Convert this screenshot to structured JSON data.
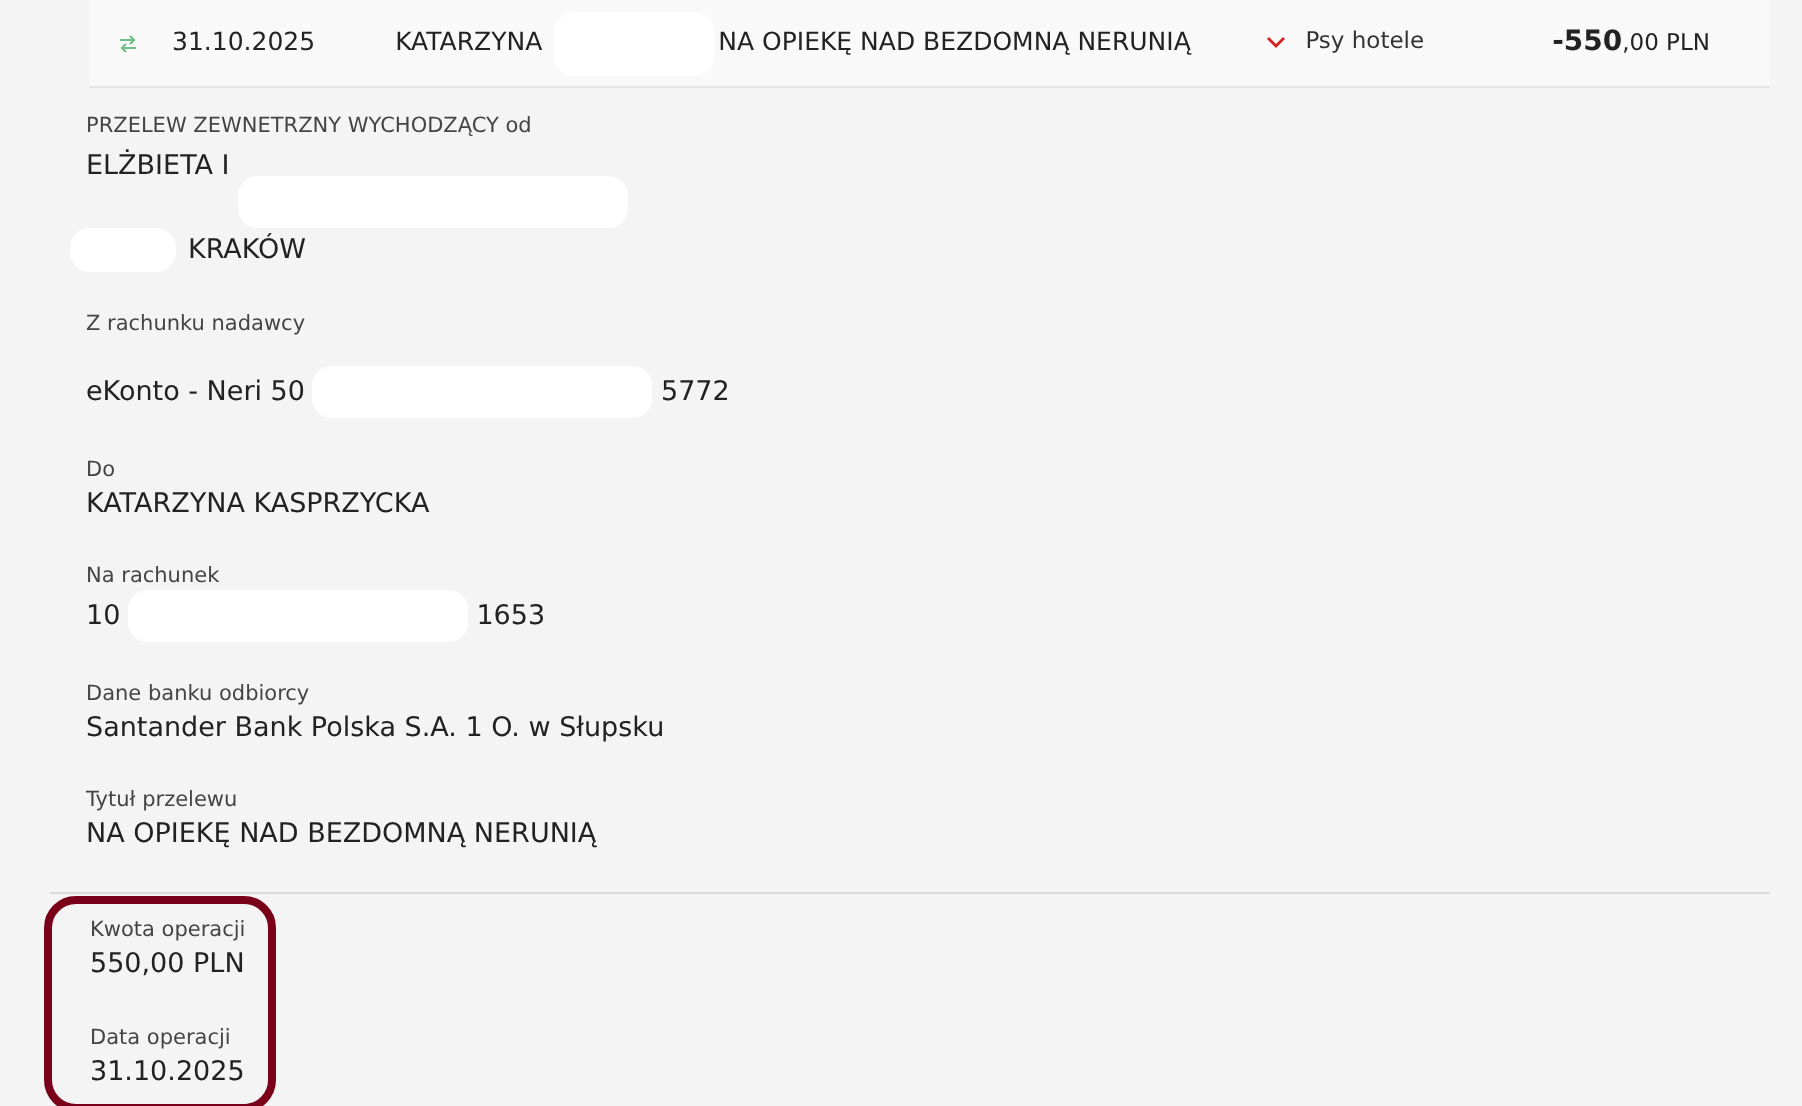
{
  "transaction": {
    "date": "31.10.2025",
    "counterparty": "KATARZYNA",
    "counterparty_redacted": true,
    "title": "NA OPIEKĘ NAD BEZDOMNĄ NERUNIĄ",
    "category": "Psy hotele",
    "expanded": true,
    "amount_main": "-550",
    "amount_rest": ",00 PLN"
  },
  "details": [
    {
      "label": "PRZELEW ZEWNETRZNY WYCHODZĄCY od",
      "lines": [
        [
          {
            "kind": "text",
            "text": "ELŻBIETA I"
          },
          {
            "kind": "redaction"
          }
        ],
        [
          {
            "kind": "redaction"
          },
          {
            "kind": "text",
            "text": "KRAKÓW"
          }
        ]
      ]
    },
    {
      "label": "Z rachunku nadawcy",
      "lines": [
        [
          {
            "kind": "text",
            "text": "eKonto - Neri 50"
          },
          {
            "kind": "redaction"
          },
          {
            "kind": "text",
            "text": "5772"
          }
        ]
      ]
    },
    {
      "label": "Do",
      "lines": [
        [
          {
            "kind": "text",
            "text": "KATARZYNA KASPRZYCKA"
          }
        ]
      ]
    },
    {
      "label": "Na rachunek",
      "lines": [
        [
          {
            "kind": "text",
            "text": "10"
          },
          {
            "kind": "redaction"
          },
          {
            "kind": "text",
            "text": "1653"
          }
        ]
      ]
    },
    {
      "label": "Dane banku odbiorcy",
      "lines": [
        [
          {
            "kind": "text",
            "text": "Santander Bank Polska S.A. 1 O. w Słupsku"
          }
        ]
      ]
    },
    {
      "label": "Tytuł przelewu",
      "lines": [
        [
          {
            "kind": "text",
            "text": "NA OPIEKĘ NAD BEZDOMNĄ NERUNIĄ"
          }
        ]
      ]
    }
  ],
  "summary": {
    "highlighted": true,
    "fields": [
      {
        "label": "Kwota operacji",
        "value": "550,00 PLN"
      },
      {
        "label": "Data operacji",
        "value": "31.10.2025"
      }
    ]
  }
}
